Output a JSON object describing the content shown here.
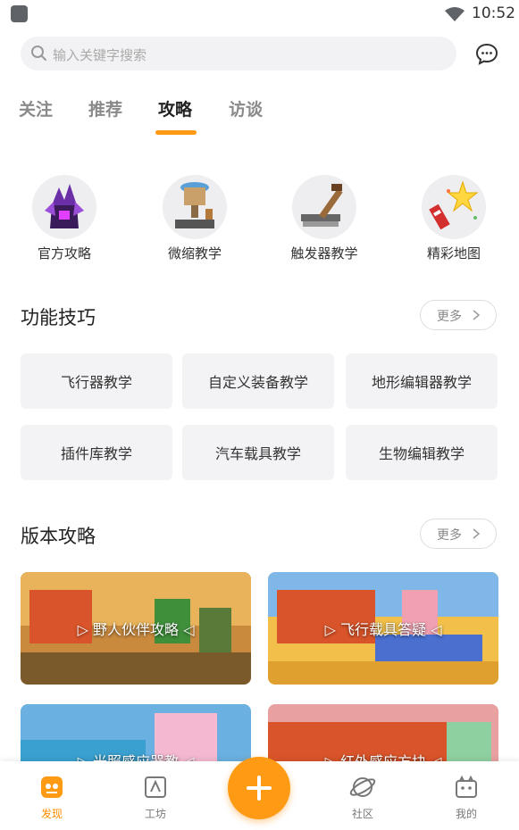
{
  "status": {
    "time": "10:52"
  },
  "search": {
    "placeholder": "输入关键字搜索"
  },
  "tabs": [
    {
      "label": "关注"
    },
    {
      "label": "推荐"
    },
    {
      "label": "攻略"
    },
    {
      "label": "访谈"
    }
  ],
  "categories": [
    {
      "label": "官方攻略",
      "icon": "dragon-icon"
    },
    {
      "label": "微缩教学",
      "icon": "microscope-icon"
    },
    {
      "label": "触发器教学",
      "icon": "lever-icon"
    },
    {
      "label": "精彩地图",
      "icon": "firework-star-icon"
    }
  ],
  "skills": {
    "title": "功能技巧",
    "more": "更多",
    "items": [
      {
        "label": "飞行器教学"
      },
      {
        "label": "自定义装备教学"
      },
      {
        "label": "地形编辑器教学"
      },
      {
        "label": "插件库教学"
      },
      {
        "label": "汽车载具教学"
      },
      {
        "label": "生物编辑教学"
      }
    ]
  },
  "guides": {
    "title": "版本攻略",
    "more": "更多",
    "cards": [
      {
        "title": "▷ 野人伙伴攻略 ◁"
      },
      {
        "title": "▷ 飞行载具答疑 ◁"
      },
      {
        "title": "▷ 光照感应器教 ◁"
      },
      {
        "title": "▷ 红外感应方块 ◁"
      }
    ]
  },
  "bottom_nav": [
    {
      "label": "发现",
      "icon": "discover-icon"
    },
    {
      "label": "工坊",
      "icon": "workshop-icon"
    },
    {
      "label": "社区",
      "icon": "planet-icon"
    },
    {
      "label": "我的",
      "icon": "profile-icon"
    }
  ],
  "colors": {
    "accent": "#ff9a14",
    "tile_bg": "#f3f3f5"
  }
}
